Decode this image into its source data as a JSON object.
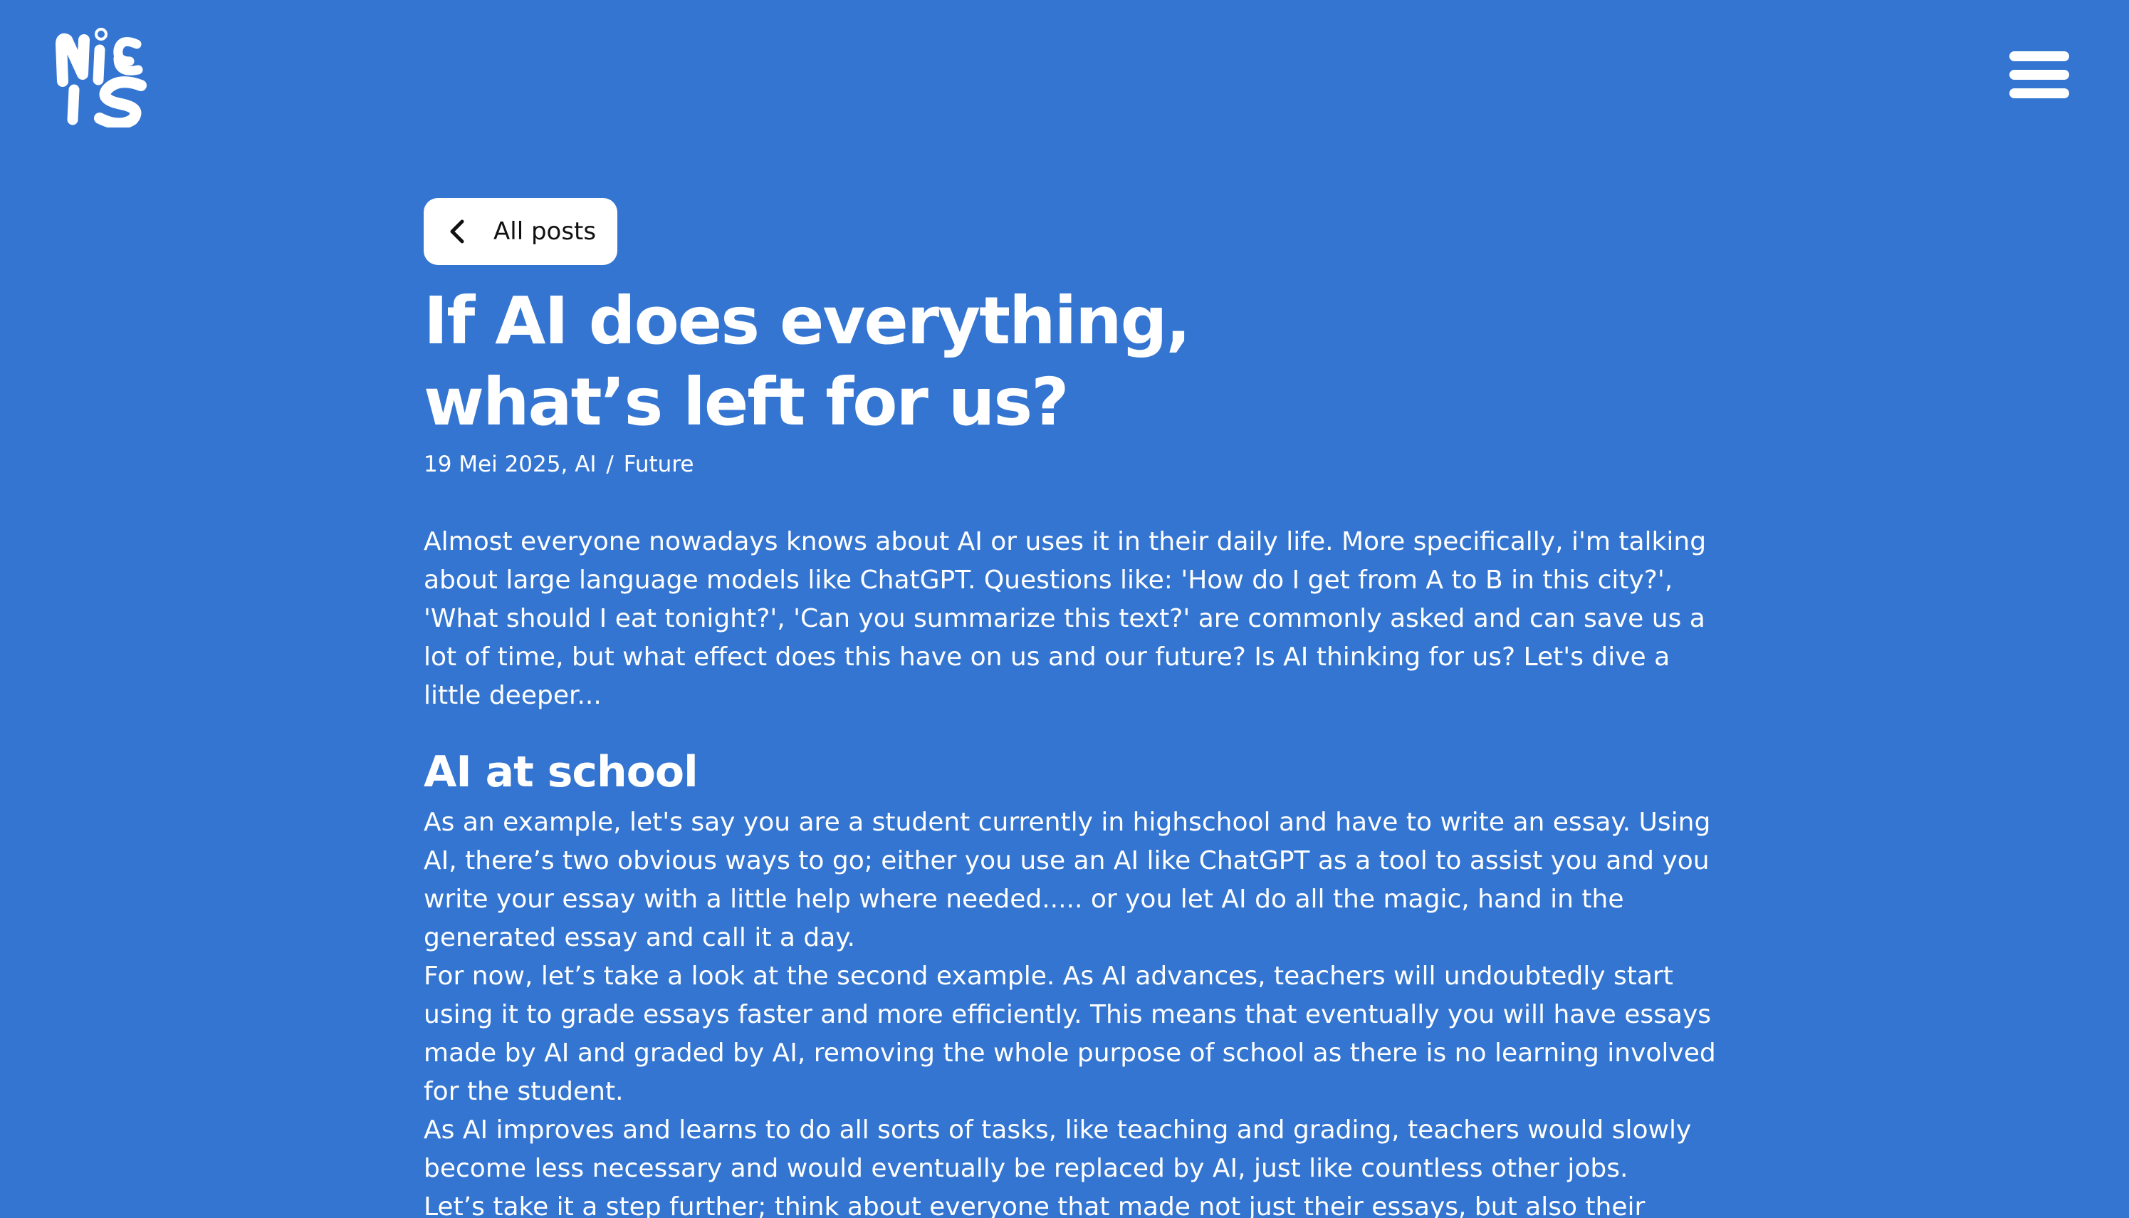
{
  "header": {
    "logo_icon": "niels-logo-icon",
    "menu_icon": "hamburger-menu-icon"
  },
  "nav": {
    "back_label": "All posts",
    "back_icon": "chevron-left-icon"
  },
  "post": {
    "title_line1": "If AI does everything,",
    "title_line2": "what’s left for us?",
    "date": "19 Mei 2025,",
    "category_1": "AI",
    "category_sep": "/",
    "category_2": "Future",
    "intro": "Almost everyone nowadays knows about AI or uses it in their daily life. More specifically, i'm talking about large language models like ChatGPT. Questions like: 'How do I get from A to B in this city?', 'What should I eat tonight?', 'Can you summarize this text?' are commonly asked and can save us a lot of time, but what effect does this have on us and our future? Is AI thinking for us? Let's dive a little deeper...",
    "section_heading": "AI at school",
    "paragraphs": [
      "As an example, let's say you are a student currently in highschool and have to write an essay. Using AI, there’s two obvious ways to go; either you use an AI like ChatGPT as a tool to assist you and you write your essay with a little help where needed..... or you let AI do all the magic, hand in the generated essay and call it a day.",
      "For now, let’s take a look at the second example. As AI advances, teachers will undoubtedly start using it to grade essays faster and more efficiently. This means that eventually you will have essays made by AI and graded by AI, removing the whole purpose of school as there is no learning involved for the student.",
      "As AI improves and learns to do all sorts of tasks, like teaching and grading, teachers would slowly become less necessary and would eventually be replaced by AI, just like countless other jobs.",
      "Let’s take it a step further; think about everyone that made not just their essays, but also their"
    ]
  },
  "colors": {
    "background": "#3375d1",
    "text": "#ffffff",
    "button_background": "#ffffff",
    "button_text": "#111111"
  }
}
